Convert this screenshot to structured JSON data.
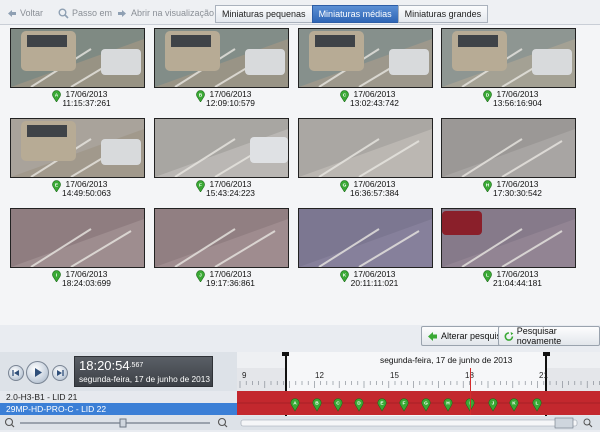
{
  "toolbar": {
    "back_label": "Voltar",
    "step_label": "Passo em",
    "open_view_label": "Abrir na visualização",
    "tabs": [
      "Miniaturas pequenas",
      "Miniaturas médias",
      "Miniaturas grandes"
    ],
    "active_tab": 1
  },
  "thumbnails": [
    {
      "marker": "A",
      "date": "17/06/2013",
      "time": "11:15:37:261"
    },
    {
      "marker": "B",
      "date": "17/06/2013",
      "time": "12:09:10:579"
    },
    {
      "marker": "C",
      "date": "17/06/2013",
      "time": "13:02:43:742"
    },
    {
      "marker": "D",
      "date": "17/06/2013",
      "time": "13:56:16:904"
    },
    {
      "marker": "E",
      "date": "17/06/2013",
      "time": "14:49:50:063"
    },
    {
      "marker": "F",
      "date": "17/06/2013",
      "time": "15:43:24:223"
    },
    {
      "marker": "G",
      "date": "17/06/2013",
      "time": "16:36:57:384"
    },
    {
      "marker": "H",
      "date": "17/06/2013",
      "time": "17:30:30:542"
    },
    {
      "marker": "I",
      "date": "17/06/2013",
      "time": "18:24:03:699"
    },
    {
      "marker": "J",
      "date": "17/06/2013",
      "time": "19:17:36:861"
    },
    {
      "marker": "K",
      "date": "17/06/2013",
      "time": "20:11:11:021"
    },
    {
      "marker": "L",
      "date": "17/06/2013",
      "time": "21:04:44:181"
    }
  ],
  "actions": {
    "change_search_label": "Alterar pesquisa",
    "search_again_label": "Pesquisar novamente"
  },
  "player": {
    "time": "18:20:54",
    "time_ms": ".567",
    "date": "segunda-feira, 17 de junho de 2013"
  },
  "tracks": [
    {
      "label": "2.0-H3-B1 - LID 21"
    },
    {
      "label": "29MP-HD-PRO-C - LID 22"
    }
  ],
  "timeline": {
    "date_label": "segunda-feira, 17 de junho de 2013",
    "hour_ticks": [
      "9",
      "12",
      "15",
      "18",
      "21"
    ],
    "markers": [
      "A",
      "B",
      "C",
      "D",
      "E",
      "F",
      "G",
      "H",
      "I",
      "J",
      "K",
      "L"
    ]
  },
  "colors": {
    "accent": "#2f66b6",
    "marker_green": "#3aa935",
    "track_red": "#b3262c",
    "selected_track": "#3b7fd6"
  }
}
